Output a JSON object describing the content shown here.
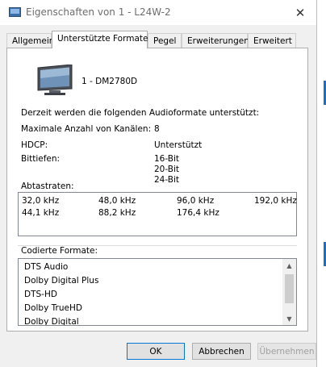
{
  "window": {
    "title": "Eigenschaften von 1 - L24W-2",
    "close_glyph": "✕"
  },
  "tabs": [
    {
      "label": "Allgemein",
      "active": false
    },
    {
      "label": "Unterstützte Formate",
      "active": true
    },
    {
      "label": "Pegel",
      "active": false
    },
    {
      "label": "Erweiterungen",
      "active": false
    },
    {
      "label": "Erweitert",
      "active": false
    }
  ],
  "device": {
    "icon": "monitor-icon",
    "name": "1 - DM2780D"
  },
  "audio": {
    "heading": "Derzeit werden die folgenden Audioformate unterstützt:",
    "max_channels_label": "Maximale Anzahl von Kanälen:",
    "max_channels_value": "8",
    "hdcp_label": "HDCP:",
    "hdcp_value": "Unterstützt",
    "bitdepth_label": "Bittiefen:",
    "bitdepths": [
      "16-Bit",
      "20-Bit",
      "24-Bit"
    ],
    "samplerates_label": "Abtastraten:",
    "samplerates": [
      [
        "32,0 kHz",
        "48,0 kHz",
        "96,0 kHz",
        "192,0 kHz"
      ],
      [
        "44,1 kHz",
        "88,2 kHz",
        "176,4 kHz",
        ""
      ]
    ]
  },
  "coded_formats": {
    "label": "Codierte Formate:",
    "items": [
      "DTS Audio",
      "Dolby Digital Plus",
      "DTS-HD",
      "Dolby TrueHD",
      "Dolby Digital"
    ],
    "scroll_up_glyph": "▲",
    "scroll_down_glyph": "▼"
  },
  "buttons": {
    "ok": "OK",
    "cancel": "Abbrechen",
    "apply": "Übernehmen"
  },
  "colors": {
    "accent": "#0078d7",
    "panel_bg": "#ffffff",
    "window_bg": "#f0f0f0"
  }
}
